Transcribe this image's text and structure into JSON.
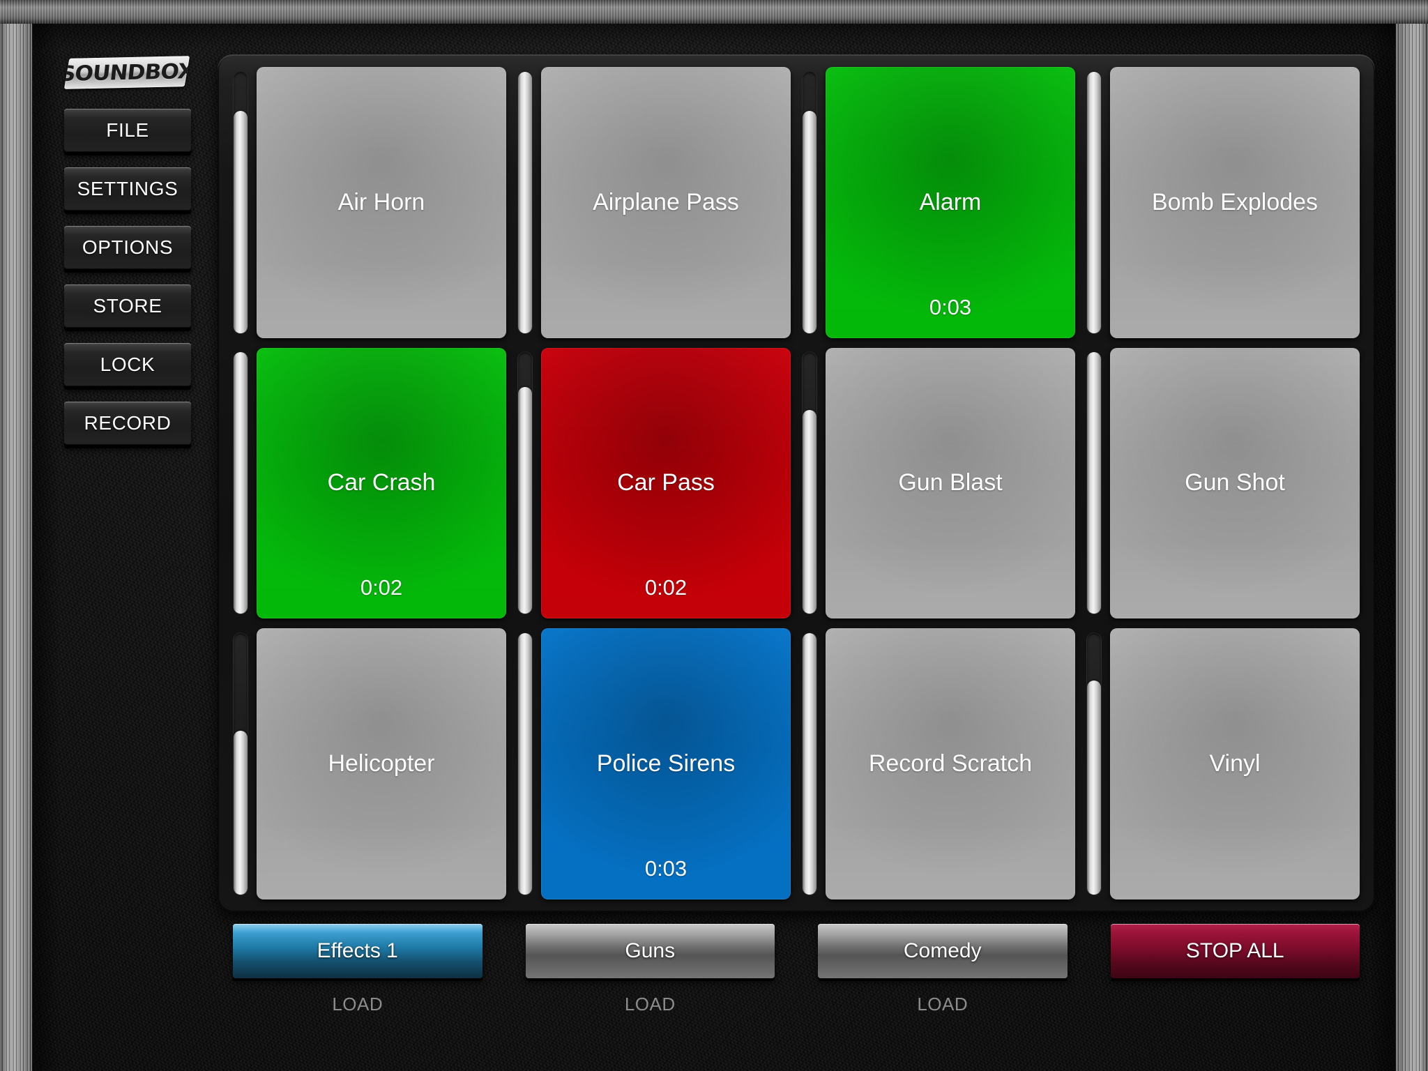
{
  "app": {
    "logo": "SOUNDBOX"
  },
  "sidebar": {
    "items": [
      {
        "label": "FILE",
        "name": "file"
      },
      {
        "label": "SETTINGS",
        "name": "settings"
      },
      {
        "label": "OPTIONS",
        "name": "options"
      },
      {
        "label": "STORE",
        "name": "store"
      },
      {
        "label": "LOCK",
        "name": "lock"
      },
      {
        "label": "RECORD",
        "name": "record"
      }
    ]
  },
  "pads": [
    {
      "label": "Air Horn",
      "timer": "",
      "state": "idle",
      "volume": 85
    },
    {
      "label": "Airplane Pass",
      "timer": "",
      "state": "idle",
      "volume": 100
    },
    {
      "label": "Alarm",
      "timer": "0:03",
      "state": "green",
      "volume": 85
    },
    {
      "label": "Bomb Explodes",
      "timer": "",
      "state": "idle",
      "volume": 100
    },
    {
      "label": "Car Crash",
      "timer": "0:02",
      "state": "green",
      "volume": 100
    },
    {
      "label": "Car Pass",
      "timer": "0:02",
      "state": "red",
      "volume": 87
    },
    {
      "label": "Gun Blast",
      "timer": "",
      "state": "idle",
      "volume": 78
    },
    {
      "label": "Gun Shot",
      "timer": "",
      "state": "idle",
      "volume": 100
    },
    {
      "label": "Helicopter",
      "timer": "",
      "state": "idle",
      "volume": 63
    },
    {
      "label": "Police Sirens",
      "timer": "0:03",
      "state": "blue",
      "volume": 100
    },
    {
      "label": "Record Scratch",
      "timer": "",
      "state": "idle",
      "volume": 100
    },
    {
      "label": "Vinyl",
      "timer": "",
      "state": "idle",
      "volume": 82
    }
  ],
  "banks": [
    {
      "label": "Effects 1",
      "load": "LOAD",
      "style": "active"
    },
    {
      "label": "Guns",
      "load": "LOAD",
      "style": "idle"
    },
    {
      "label": "Comedy",
      "load": "LOAD",
      "style": "idle"
    },
    {
      "label": "STOP ALL",
      "load": "",
      "style": "stop"
    }
  ],
  "colors": {
    "pad_green": "#05bb0c",
    "pad_red": "#c80009",
    "pad_blue": "#0571c4",
    "pad_idle": "#a9a9a9",
    "bank_active": "#1f7ba8",
    "bank_stop": "#7d0c2b"
  }
}
